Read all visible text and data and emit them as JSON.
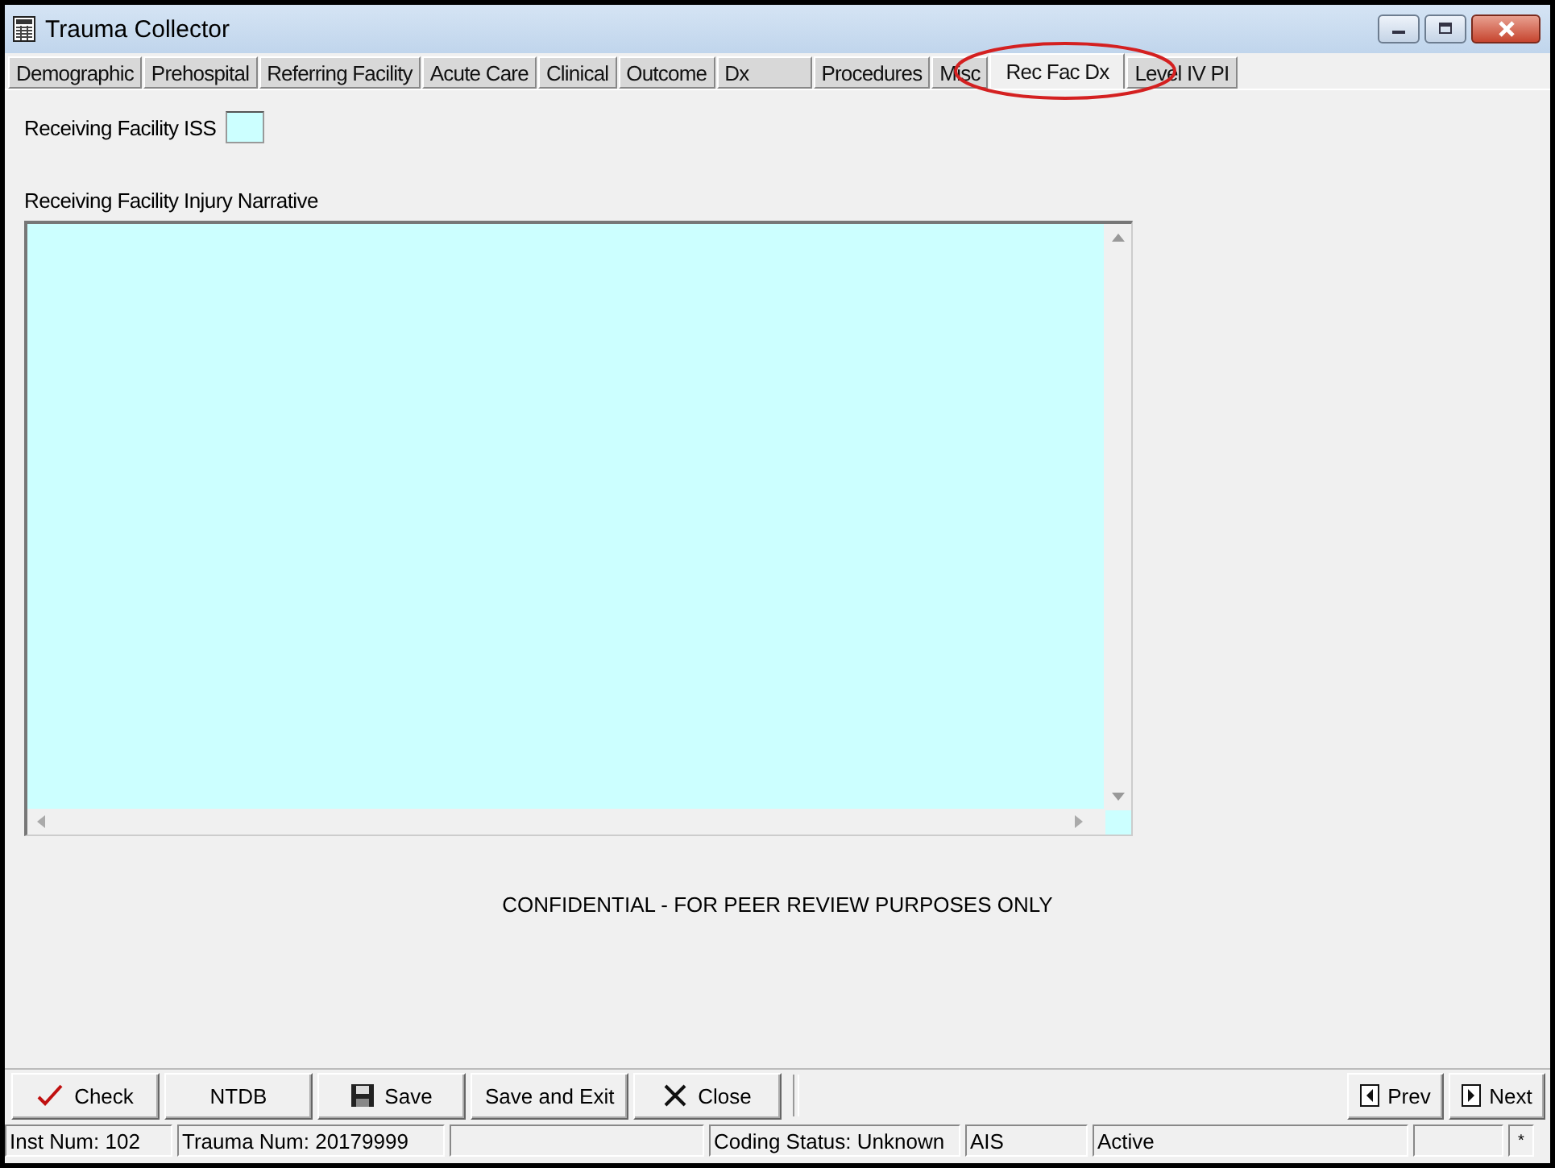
{
  "window": {
    "title": "Trauma Collector"
  },
  "tabs": [
    {
      "label": "Demographic",
      "selected": false,
      "circled": false
    },
    {
      "label": "Prehospital",
      "selected": false,
      "circled": false
    },
    {
      "label": "Referring Facility",
      "selected": false,
      "circled": false
    },
    {
      "label": "Acute Care",
      "selected": false,
      "circled": false
    },
    {
      "label": "Clinical",
      "selected": false,
      "circled": false
    },
    {
      "label": "Outcome",
      "selected": false,
      "circled": false
    },
    {
      "label": "Dx",
      "selected": false,
      "circled": false
    },
    {
      "label": "Procedures",
      "selected": false,
      "circled": false
    },
    {
      "label": "Misc",
      "selected": false,
      "circled": false
    },
    {
      "label": "Rec Fac Dx",
      "selected": true,
      "circled": true
    },
    {
      "label": "Level IV PI",
      "selected": false,
      "circled": false
    }
  ],
  "iss_field": {
    "label": "Receiving Facility ISS"
  },
  "narrative": {
    "label": "Receiving Facility Injury Narrative"
  },
  "notice": "CONFIDENTIAL - FOR PEER REVIEW PURPOSES ONLY",
  "buttons": [
    {
      "label": "Check",
      "kind": "check"
    },
    {
      "label": "NTDB",
      "kind": "plain"
    },
    {
      "label": "Save",
      "kind": "save"
    },
    {
      "label": "Save and Exit",
      "kind": "plain"
    },
    {
      "label": "Close",
      "kind": "close"
    }
  ],
  "nav_buttons": [
    {
      "label": "Prev",
      "kind": "prev"
    },
    {
      "label": "Next",
      "kind": "next"
    }
  ],
  "status_bar": [
    {
      "kind": "text",
      "text": "Inst Num: 102"
    },
    {
      "kind": "text",
      "text": "Trauma Num: 20179999"
    },
    {
      "kind": "empty"
    },
    {
      "kind": "text",
      "text": "Coding Status: Unknown"
    },
    {
      "kind": "text",
      "text": "AIS"
    },
    {
      "kind": "text",
      "text": "Active"
    },
    {
      "kind": "empty"
    },
    {
      "kind": "text",
      "text": "*"
    }
  ]
}
